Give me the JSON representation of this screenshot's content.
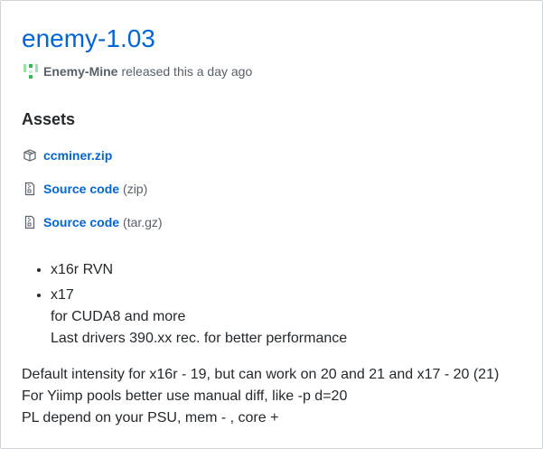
{
  "release": {
    "title": "enemy-1.03",
    "author": "Enemy-Mine",
    "released_text": "released this a day ago"
  },
  "assets": {
    "heading": "Assets",
    "items": [
      {
        "label": "ccminer.zip",
        "ext": "",
        "icon": "package-icon"
      },
      {
        "label": "Source code",
        "ext": "(zip)",
        "icon": "file-zip-icon"
      },
      {
        "label": "Source code",
        "ext": "(tar.gz)",
        "icon": "file-zip-icon"
      }
    ]
  },
  "notes": {
    "bullets": [
      {
        "text": "x16r RVN",
        "lines": []
      },
      {
        "text": "x17",
        "lines": [
          "for CUDA8 and more",
          "Last drivers 390.xx rec. for better performance"
        ]
      }
    ],
    "paragraph_lines": [
      "Default intensity for x16r - 19, but can work on 20 and 21 and x17 - 20 (21)",
      "For Yiimp pools better use manual diff, like -p d=20",
      "PL depend on your PSU, mem - , core +"
    ]
  },
  "colors": {
    "link": "#0366d6",
    "text": "#24292e",
    "muted": "#586069",
    "avatar": "#2cbe4e"
  }
}
